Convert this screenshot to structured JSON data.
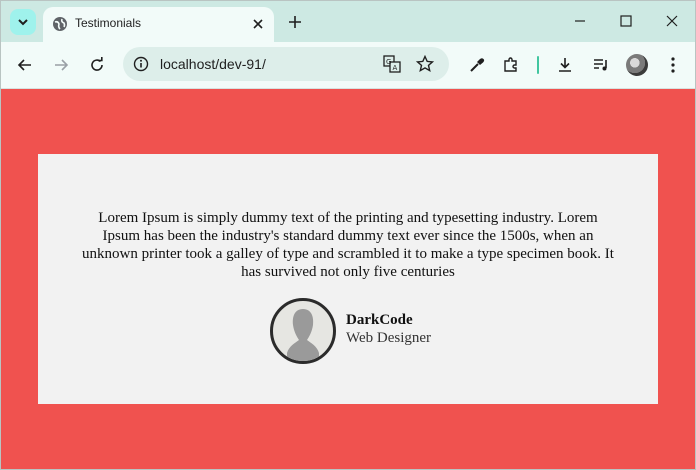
{
  "browser": {
    "tab_title": "Testimonials",
    "url": "localhost/dev-91/"
  },
  "testimonial": {
    "quote": "Lorem Ipsum is simply dummy text of the printing and typesetting industry. Lorem Ipsum has been the industry's standard dummy text ever since the 1500s, when an unknown printer took a galley of type and scrambled it to make a type specimen book. It has survived not only five centuries",
    "name": "DarkCode",
    "role": "Web Designer"
  },
  "colors": {
    "page_background": "#f0524f",
    "card_background": "#f2f2f2",
    "tabbar": "#cde9e3",
    "toolbar": "#f2fbf9"
  },
  "icons": [
    "tab-search-icon",
    "globe-icon",
    "close-icon",
    "plus-icon",
    "minimize-icon",
    "maximize-icon",
    "back-arrow-icon",
    "forward-arrow-icon",
    "reload-icon",
    "site-info-icon",
    "translate-icon",
    "star-icon",
    "eyedropper-icon",
    "extensions-icon",
    "download-icon",
    "media-controls-icon",
    "menu-dots-icon"
  ]
}
